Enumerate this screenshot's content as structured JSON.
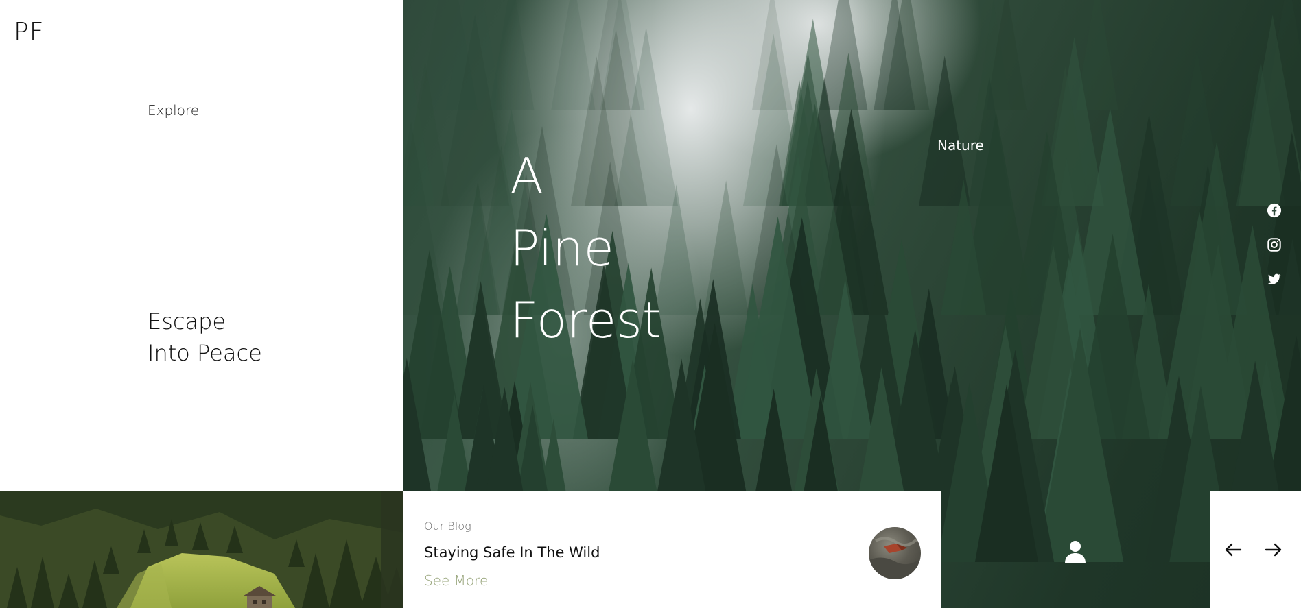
{
  "brand": {
    "logo": "PF"
  },
  "nav": {
    "explore_label": "Explore"
  },
  "tagline": {
    "line1": "Escape",
    "line2": "Into Peace"
  },
  "hero": {
    "title_lines": [
      "A",
      "Pine",
      "Forest"
    ],
    "category": "Nature"
  },
  "socials": [
    {
      "icon": "facebook-icon"
    },
    {
      "icon": "instagram-icon"
    },
    {
      "icon": "twitter-icon"
    }
  ],
  "blog": {
    "kicker": "Our Blog",
    "title": "Staying Safe In The Wild",
    "more_label": "See More"
  },
  "controls": {
    "user_icon": "user-icon",
    "prev_icon": "arrow-left-icon",
    "next_icon": "arrow-right-icon"
  },
  "colors": {
    "accent": "#97a47a",
    "panel": "#ffffff",
    "hero_text": "#ffffff",
    "forest_dark": "#1f3628"
  }
}
